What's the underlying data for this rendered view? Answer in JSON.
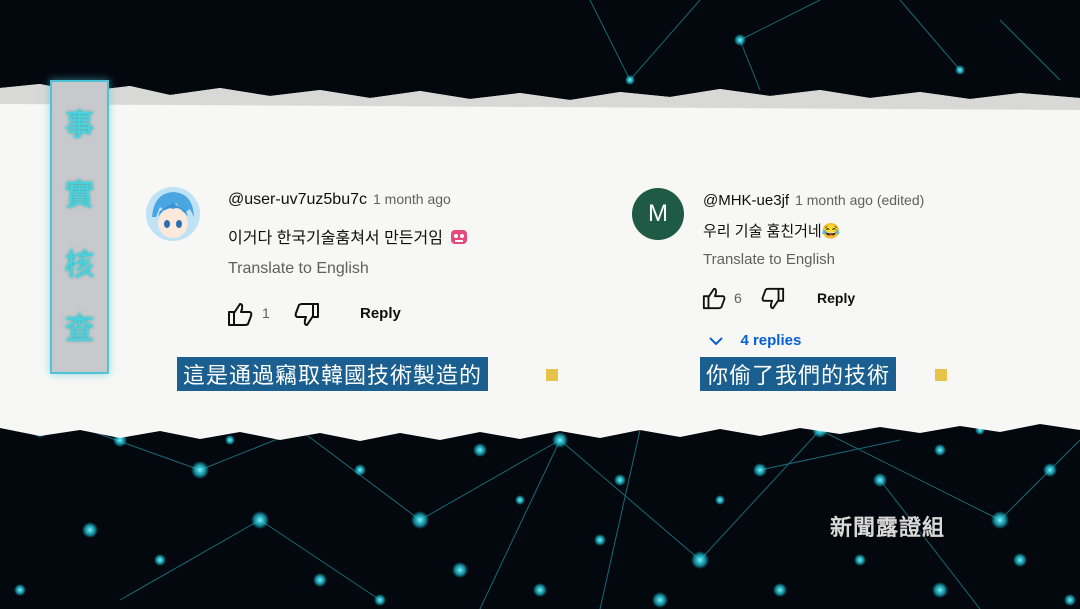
{
  "side_panel": {
    "chars": [
      "事",
      "實",
      "核",
      "查"
    ]
  },
  "comments": [
    {
      "username": "@user-uv7uz5bu7c",
      "time": "1 month ago",
      "text": "이거다 한국기술훔쳐서 만든거임",
      "emoji_icon": "sticker-icon",
      "translate": "Translate to English",
      "likes": "1",
      "reply_label": "Reply",
      "caption": "這是通過竊取韓國技術製造的"
    },
    {
      "username": "@MHK-ue3jf",
      "time": "1 month ago (edited)",
      "avatar_letter": "M",
      "text": "우리 기술 훔친거네",
      "emoji": "😂",
      "translate": "Translate to English",
      "likes": "6",
      "reply_label": "Reply",
      "replies_label": "4 replies",
      "caption": "你偷了我們的技術"
    }
  ],
  "watermark": "新聞露證組",
  "colors": {
    "caption_bg": "#1a5f8f",
    "accent_cyan": "#48d3e0",
    "reply_link": "#065fd4",
    "avatar_m": "#1e5a45"
  }
}
